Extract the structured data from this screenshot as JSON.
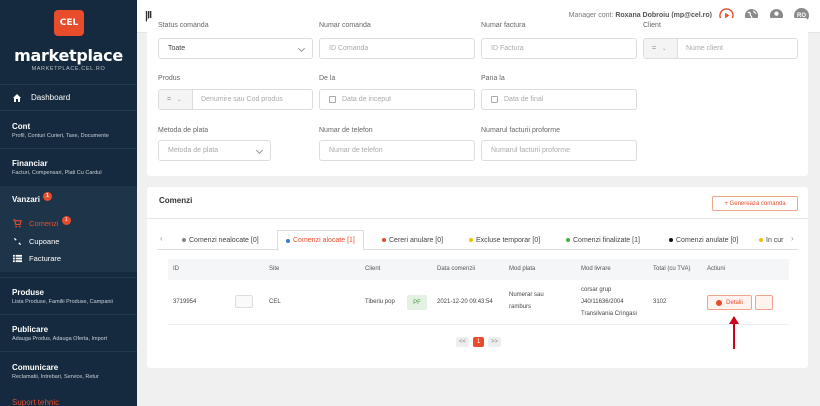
{
  "brand": {
    "logo_text": "CEL",
    "title": "marketplace",
    "subtitle": "MARKETPLACE.CEL.RO"
  },
  "sidebar": {
    "dashboard": "Dashboard",
    "sections": [
      {
        "title": "Cont",
        "sub": "Profil, Conturi Curieri, Taxe, Documente"
      },
      {
        "title": "Financiar",
        "sub": "Facturi, Compensari, Plati Cu Cardul"
      },
      {
        "title": "Vanzari",
        "badge": "1"
      },
      {
        "title": "Produse",
        "sub": "Lista Produse, Familii Produse, Campanii"
      },
      {
        "title": "Publicare",
        "sub": "Adauga Produs, Adauga Oferta, Import"
      },
      {
        "title": "Comunicare",
        "sub": "Reclamatii, Intrebari, Service, Retur"
      }
    ],
    "vanzari_items": [
      {
        "label": "Comenzi",
        "badge": "1"
      },
      {
        "label": "Cupoane"
      },
      {
        "label": "Facturare"
      }
    ],
    "suport": "Suport tehnic"
  },
  "header": {
    "manager_label": "Manager cont:",
    "manager_name": "Roxana Dobroiu (mp@cel.ro)",
    "avatar_initials": "RO"
  },
  "filters": {
    "status_label": "Status comanda",
    "status_value": "Toate",
    "order_no_label": "Numar comanda",
    "order_no_placeholder": "ID Comanda",
    "invoice_no_label": "Numar factura",
    "invoice_no_placeholder": "ID Factura",
    "client_label": "Client",
    "client_prefix": "=",
    "client_placeholder": "Nume client",
    "product_label": "Produs",
    "product_prefix": "=",
    "product_placeholder": "Denumire sau Cod produs",
    "from_label": "De la",
    "from_placeholder": "Data de inceput",
    "to_label": "Pana la",
    "to_placeholder": "Data de final",
    "payment_label": "Metoda de plata",
    "payment_placeholder": "Metoda de plata",
    "phone_label": "Numar de telefon",
    "phone_placeholder": "Numar de telefon",
    "proforma_label": "Numarul facturii proforme",
    "proforma_placeholder": "Numarul facturii proforme"
  },
  "orders": {
    "title": "Comenzi",
    "generate_button": "+ Genereaza comanda",
    "tabs": [
      {
        "label": "Comenzi nealocate [0]",
        "color": "#888888"
      },
      {
        "label": "Comenzi alocate [1]",
        "color": "#3b7dd8"
      },
      {
        "label": "Cereri anulare [0]",
        "color": "#e84c2b"
      },
      {
        "label": "Excluse temporar [0]",
        "color": "#f0c000"
      },
      {
        "label": "Comenzi finalizate [1]",
        "color": "#3cb043"
      },
      {
        "label": "Comenzi anulate [0]",
        "color": "#111111"
      },
      {
        "label": "In cur",
        "color": "#f0c000"
      }
    ],
    "columns": [
      "ID",
      "Site",
      "Client",
      "Data comenzii",
      "Mod plata",
      "Mod livrare",
      "Total (cu TVA)",
      "Actiuni"
    ],
    "rows": [
      {
        "id": "3719954",
        "site": "CEL",
        "client": "Tiberiu pop",
        "client_badge": "PF",
        "date": "2021-12-20 09:43:54",
        "payment_line1": "Numerar sau",
        "payment_line2": "ramburs",
        "delivery_line1": "corsar grup",
        "delivery_line2": "J40/11636/2004",
        "delivery_line3": "Transilvania Cringasi",
        "total": "3102",
        "action": "Detalii"
      }
    ],
    "pagination": {
      "prev": "<<",
      "current": "1",
      "next": ">>"
    }
  },
  "colors": {
    "accent": "#e84c2b",
    "sidebar": "#152a3e",
    "annotation_arrow": "#d0021b"
  }
}
